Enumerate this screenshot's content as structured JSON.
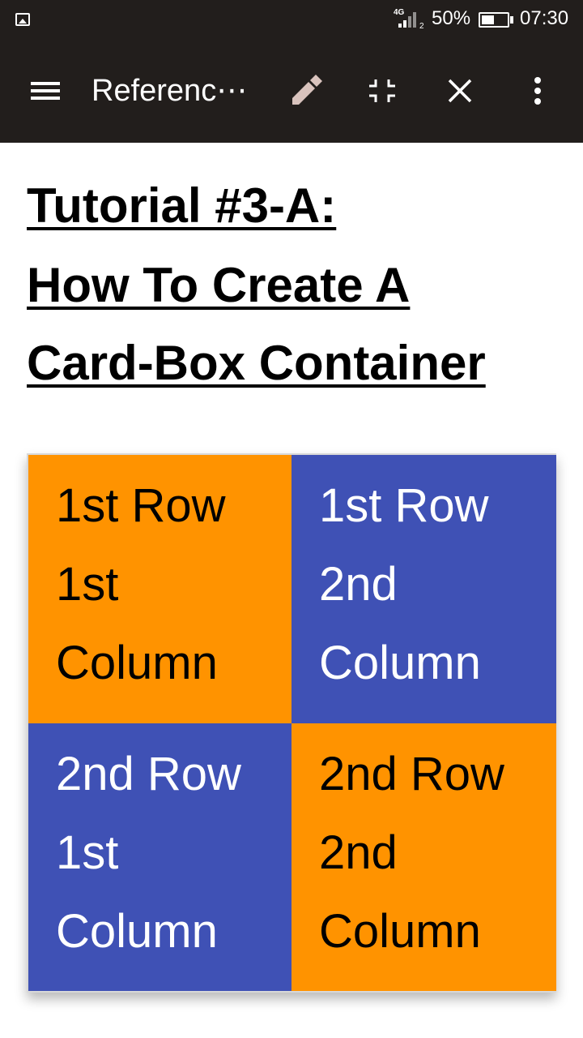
{
  "status_bar": {
    "network": "4G",
    "sim": "2",
    "battery_percent": "50%",
    "battery_level": 0.5,
    "time": "07:30",
    "icons": [
      "gallery-icon",
      "signal-icon",
      "battery-icon"
    ]
  },
  "toolbar": {
    "title": "Referenc⋯",
    "icons": [
      "menu-icon",
      "pencil-icon",
      "shrink-icon",
      "close-icon",
      "more-vert-icon"
    ]
  },
  "article": {
    "title_lines": [
      "Tutorial #3-A:",
      "How To Create A",
      "Card-Box Container"
    ]
  },
  "card_box": {
    "colors": {
      "orange": "#ff9300",
      "indigo": "#3f51b5",
      "dark_text": "#000000",
      "light_text": "#ffffff"
    },
    "cells": [
      {
        "lines": [
          "1st Row",
          "1st",
          "Column"
        ],
        "bg": "#ff9300",
        "fg": "#000000"
      },
      {
        "lines": [
          "1st Row",
          "2nd",
          "Column"
        ],
        "bg": "#3f51b5",
        "fg": "#ffffff"
      },
      {
        "lines": [
          "2nd Row",
          "1st",
          "Column"
        ],
        "bg": "#3f51b5",
        "fg": "#ffffff"
      },
      {
        "lines": [
          "2nd Row",
          "2nd",
          "Column"
        ],
        "bg": "#ff9300",
        "fg": "#000000"
      }
    ]
  }
}
